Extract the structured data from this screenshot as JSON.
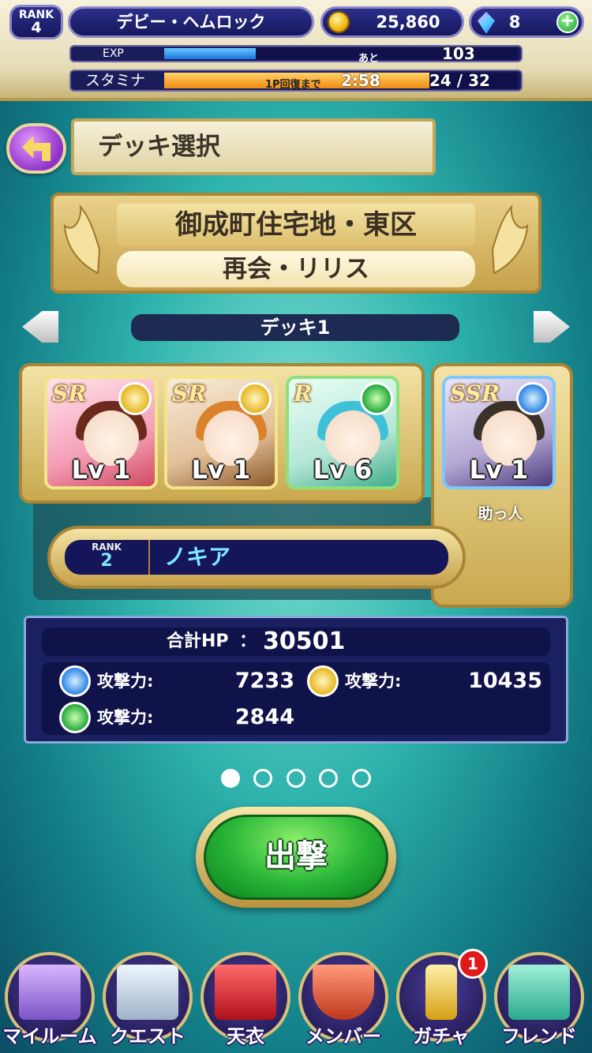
{
  "hud": {
    "rank_label": "RANK",
    "rank_value": "4",
    "player_name": "デビー・ヘムロック",
    "coins": "25,860",
    "gems": "8",
    "exp_label": "EXP",
    "exp_remaining_prefix": "あと",
    "exp_remaining": "103",
    "exp_progress": 0.26,
    "stamina_label": "スタミナ",
    "stamina_recover_label": "1P回復まで",
    "stamina_timer": "2:58",
    "stamina_value": "24 / 32",
    "stamina_progress": 0.75
  },
  "header": {
    "title": "デッキ選択"
  },
  "quest": {
    "area": "御成町住宅地・東区",
    "name": "再会・リリス"
  },
  "deck": {
    "title": "デッキ1",
    "cards": [
      {
        "rarity": "SR",
        "attribute": "sun-icon",
        "level": "Lv 1"
      },
      {
        "rarity": "SR",
        "attribute": "sun-icon",
        "level": "Lv 1"
      },
      {
        "rarity": "R",
        "attribute": "leaf-icon",
        "level": "Lv 6"
      }
    ],
    "helper": {
      "rarity": "SSR",
      "attribute": "water-icon",
      "level": "Lv 1",
      "label": "助っ人"
    }
  },
  "leader": {
    "rank_label": "RANK",
    "rank_value": "2",
    "name": "ノキア"
  },
  "stats": {
    "hp_label": "合計HP",
    "hp_sep": "：",
    "hp_value": "30501",
    "water_attack_label": "攻撃力:",
    "water_attack": "7233",
    "sun_attack_label": "攻撃力:",
    "sun_attack": "10435",
    "leaf_attack_label": "攻撃力:",
    "leaf_attack": "2844"
  },
  "pagination": {
    "count": 5,
    "active": 0
  },
  "sortie": {
    "label": "出撃"
  },
  "bottom_nav": [
    {
      "label": "マイルーム",
      "icon": "room-icon"
    },
    {
      "label": "クエスト",
      "icon": "building-icon"
    },
    {
      "label": "天衣",
      "icon": "dress-icon"
    },
    {
      "label": "メンバー",
      "icon": "shield-icon"
    },
    {
      "label": "ガチャ",
      "icon": "wand-icon",
      "badge": "1"
    },
    {
      "label": "フレンド",
      "icon": "handshake-icon"
    }
  ],
  "colors": {
    "accent_gold": "#c6a14a",
    "panel_navy": "#1a2060",
    "highlight_cyan": "#7de8ff",
    "sortie_green": "#26b436"
  }
}
